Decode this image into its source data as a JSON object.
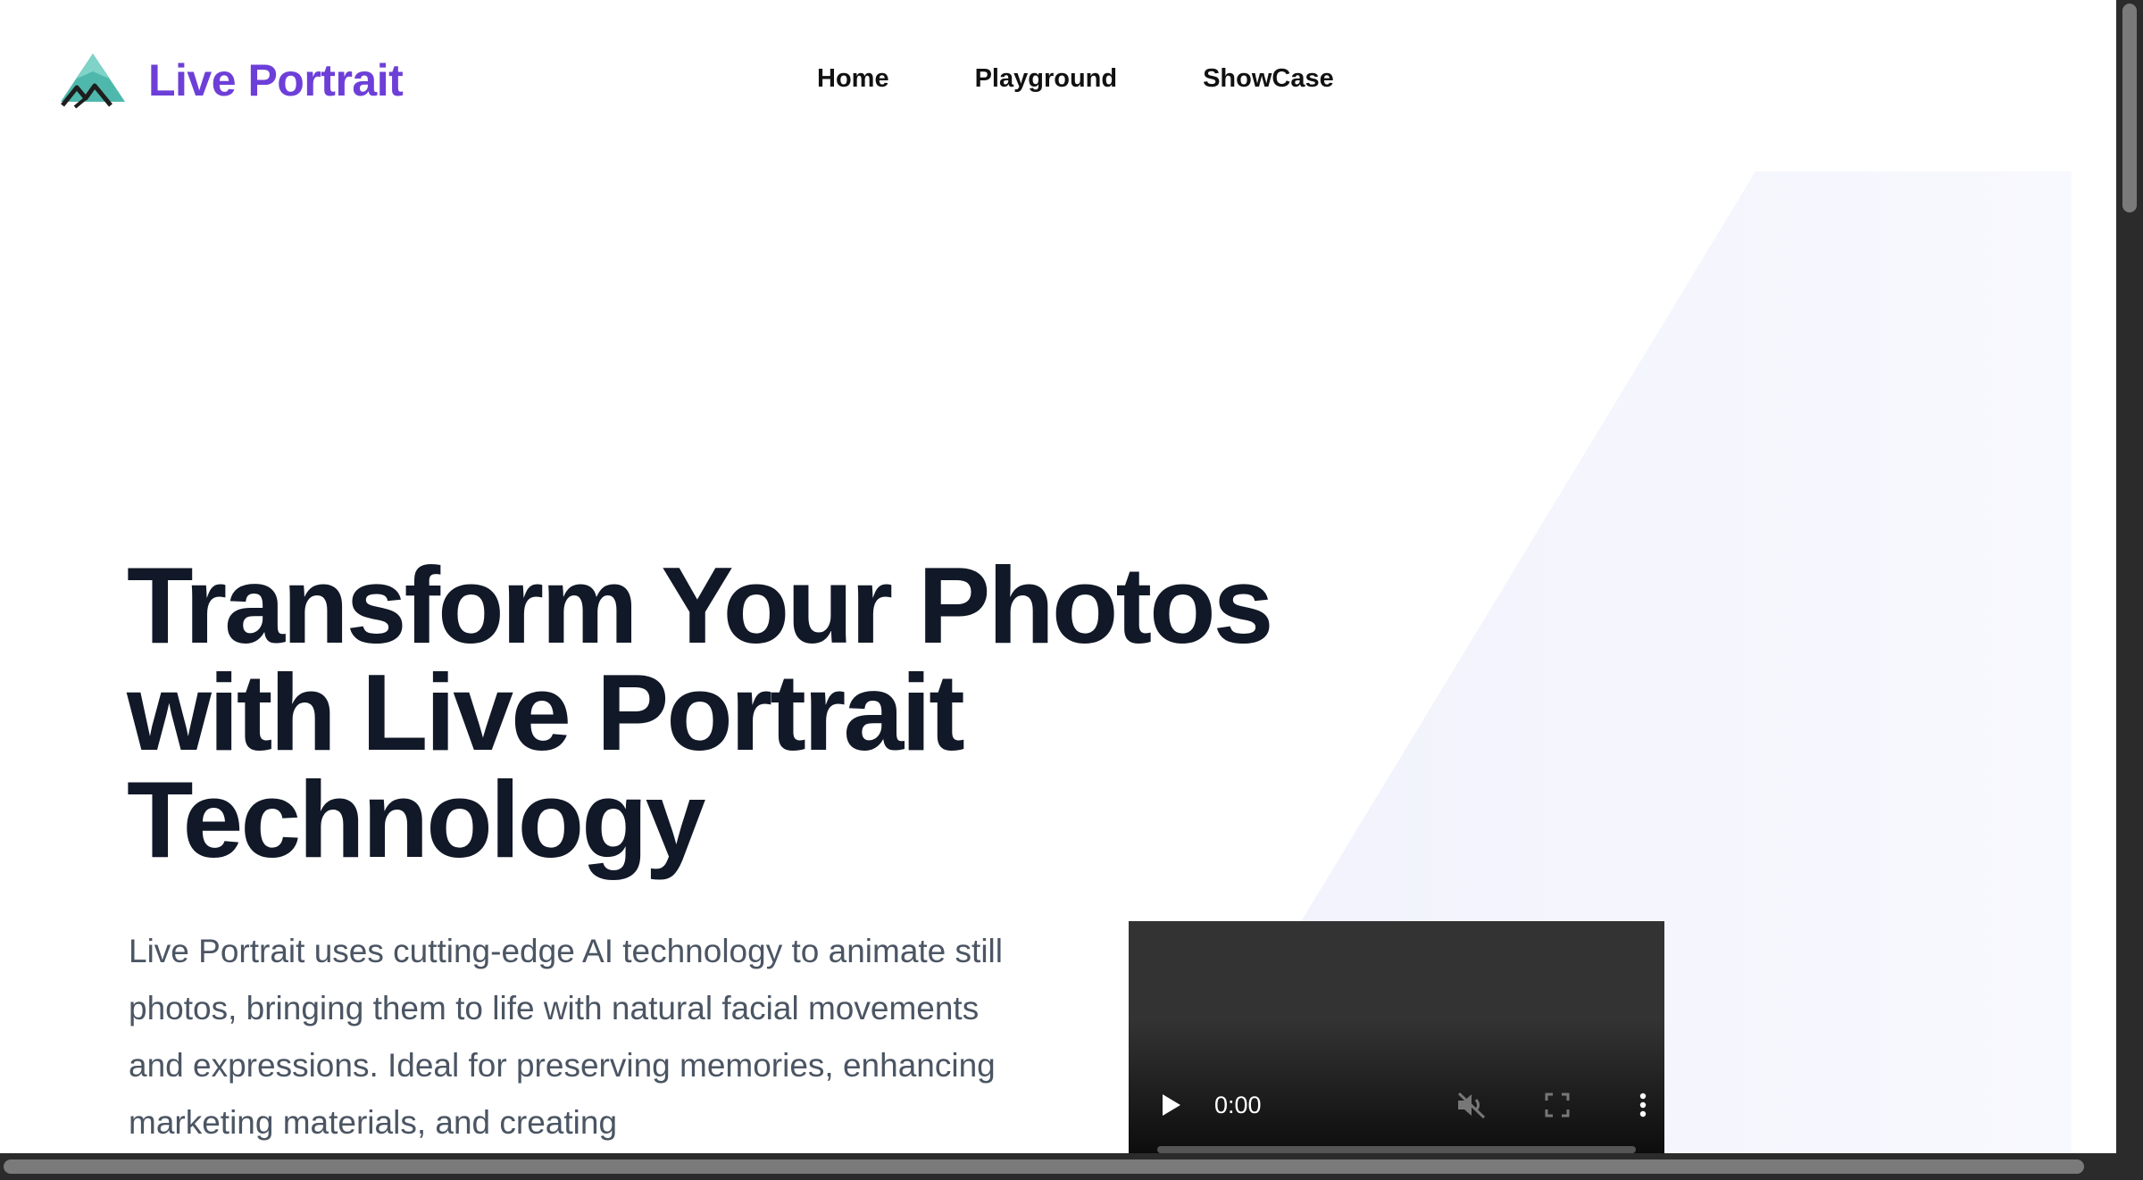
{
  "header": {
    "brand": "Live Portrait",
    "logo_icon": "mountain-logo-icon",
    "brand_color": "#6d3fd8",
    "nav": [
      {
        "label": "Home"
      },
      {
        "label": "Playground"
      },
      {
        "label": "ShowCase"
      }
    ]
  },
  "hero": {
    "title_line1": "Transform Your Photos",
    "title_line2": "with Live Portrait",
    "title_line3": "Technology",
    "description": "Live Portrait uses cutting-edge AI technology to animate still photos, bringing them to life with natural facial movements and expressions. Ideal for preserving memories, enhancing marketing materials, and creating",
    "title_color": "#111827",
    "text_color": "#4b5563"
  },
  "video": {
    "time": "0:00",
    "progress": 0,
    "controls": [
      "play-icon",
      "mute-icon",
      "fullscreen-icon",
      "more-options-icon"
    ]
  }
}
